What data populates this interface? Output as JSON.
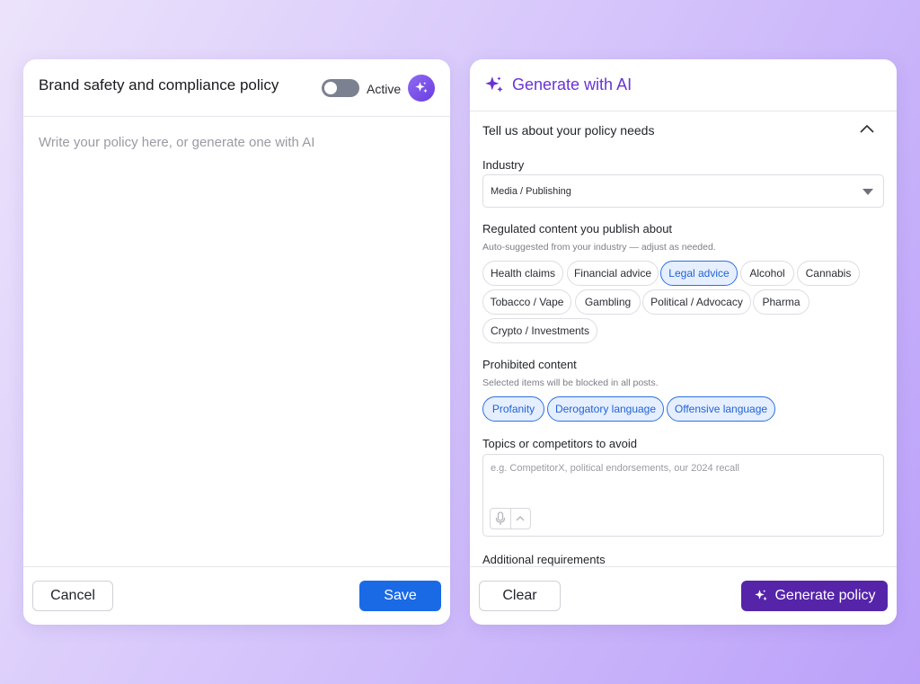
{
  "left_panel": {
    "title": "Brand safety and compliance policy",
    "toggle_state": "off",
    "active_label": "Active",
    "policy_placeholder": "Write your policy here, or generate one with AI",
    "cancel_label": "Cancel",
    "save_label": "Save"
  },
  "right_panel": {
    "title": "Generate with AI",
    "section_title": "Tell us about your policy needs",
    "industry": {
      "label": "Industry",
      "value": "Media / Publishing"
    },
    "regulated": {
      "label": "Regulated content you publish about",
      "hint": "Auto-suggested from your industry — adjust as needed.",
      "chips": [
        {
          "label": "Health claims",
          "selected": false
        },
        {
          "label": "Financial advice",
          "selected": false
        },
        {
          "label": "Legal advice",
          "selected": true
        },
        {
          "label": "Alcohol",
          "selected": false
        },
        {
          "label": "Cannabis",
          "selected": false
        },
        {
          "label": "Tobacco / Vape",
          "selected": false
        },
        {
          "label": "Gambling",
          "selected": false
        },
        {
          "label": "Political / Advocacy",
          "selected": false
        },
        {
          "label": "Pharma",
          "selected": false
        },
        {
          "label": "Crypto / Investments",
          "selected": false
        }
      ]
    },
    "prohibited": {
      "label": "Prohibited content",
      "hint": "Selected items will be blocked in all posts.",
      "chips": [
        {
          "label": "Profanity",
          "selected": true
        },
        {
          "label": "Derogatory language",
          "selected": true
        },
        {
          "label": "Offensive language",
          "selected": true
        }
      ]
    },
    "avoid": {
      "label": "Topics or competitors to avoid",
      "placeholder": "e.g. CompetitorX, political endorsements, our 2024 recall"
    },
    "additional_label": "Additional requirements",
    "clear_label": "Clear",
    "generate_label": "Generate policy"
  },
  "colors": {
    "primary_blue": "#1a6ae6",
    "ai_purple": "#6a33d4",
    "generate_button": "#5524a9",
    "chip_selected_bg": "#e5efff"
  }
}
